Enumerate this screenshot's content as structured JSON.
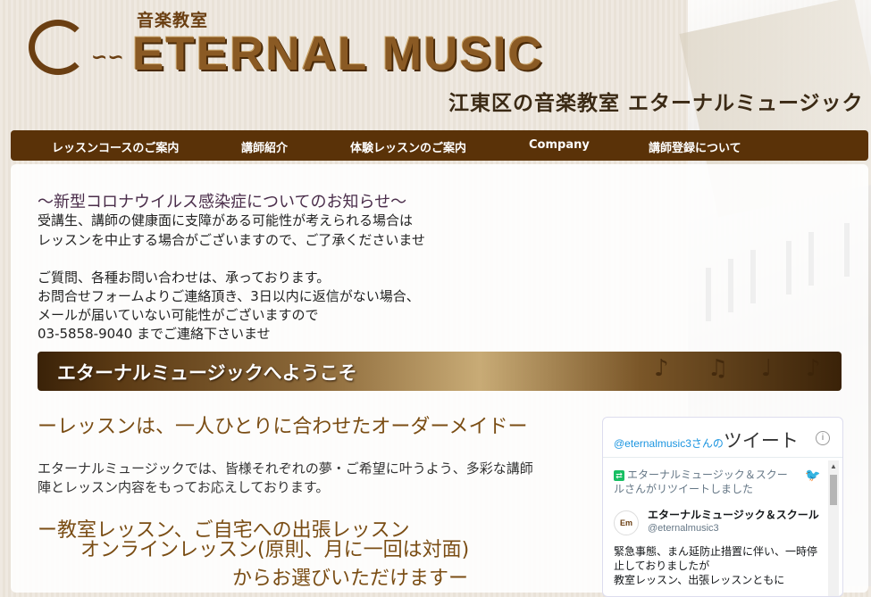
{
  "header": {
    "logo_sub": "音楽教室",
    "logo_text": "ETERNAL MUSIC",
    "tagline": "江東区の音楽教室 エターナルミュージック"
  },
  "nav": {
    "items": [
      {
        "label": "レッスンコースのご案内"
      },
      {
        "label": "講師紹介"
      },
      {
        "label": "体験レッスンのご案内"
      },
      {
        "label": "Company"
      },
      {
        "label": "講師登録について"
      }
    ]
  },
  "notice": {
    "title": "～新型コロナウイルス感染症についてのお知らせ～",
    "lines": [
      "受講生、講師の健康面に支障がある可能性が考えられる場合は",
      "レッスンを中止する場合がございますので、ご了承くださいませ",
      "ご質問、各種お問い合わせは、承っております。",
      "お問合せフォームよりご連絡頂き、3日以内に返信がない場合、",
      "メールが届いていない可能性がございますので",
      "03-5858-9040 までご連絡下さいませ"
    ]
  },
  "welcome": {
    "banner_text": "エターナルミュージックへようこそ"
  },
  "lesson": {
    "title": "ーレッスンは、一人ひとりに合わせたオーダーメイドー",
    "desc_lines": [
      "エターナルミュージックでは、皆様それぞれの夢・ご希望に叶うよう、多彩な講師",
      "陣とレッスン内容をもってお応えしております。"
    ],
    "sub_lines": [
      "ー教室レッスン、ご自宅への出張レッスン",
      "オンラインレッスン(原則、月に一回は対面)",
      "からお選びいただけますー"
    ]
  },
  "twitter": {
    "handle": "@eternalmusic3さんの",
    "tweets_label": "ツイート",
    "retweet_notice": "エターナルミュージック＆スクールさんがリツイートしました",
    "account_name": "エターナルミュージック＆スクール",
    "account_user": "@eternalmusic3",
    "body": "緊急事態、まん延防止措置に伴い、一時停止しておりましたが\n教室レッスン、出張レッスンともに"
  }
}
